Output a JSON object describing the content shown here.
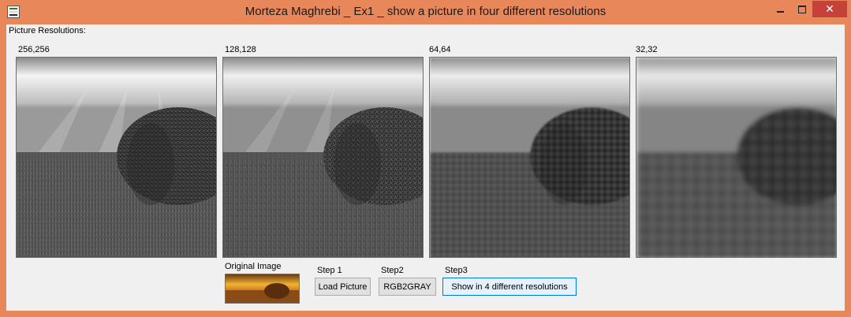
{
  "window": {
    "title": "Morteza Maghrebi _ Ex1 _ show a picture in four different resolutions",
    "minimize_glyph": "",
    "close_glyph": "✕"
  },
  "form": {
    "group_label": "Picture Resolutions:",
    "resolutions": [
      "256,256",
      "128,128",
      "64,64",
      "32,32"
    ],
    "original_label": "Original Image",
    "steps": [
      {
        "label": "Step 1",
        "button": "Load Picture"
      },
      {
        "label": "Step2",
        "button": "RGB2GRAY"
      },
      {
        "label": "Step3",
        "button": "Show in 4 different resolutions"
      }
    ]
  },
  "colors": {
    "frame": "#e8875a",
    "client": "#f0f0f0",
    "close": "#c7413b",
    "focus_border": "#0078d7"
  }
}
